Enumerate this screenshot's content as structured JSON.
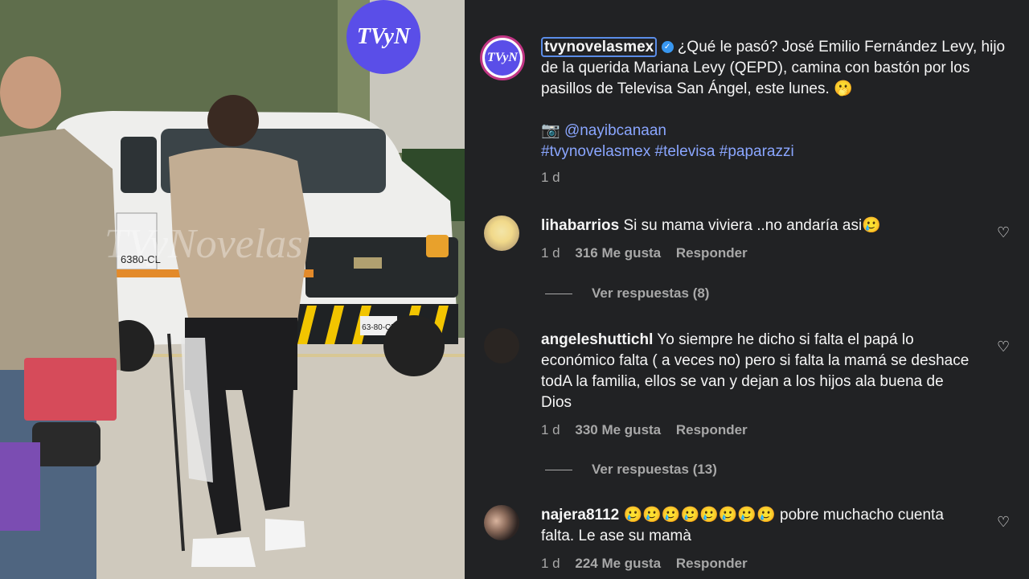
{
  "photo": {
    "logo_text": "TVyN",
    "watermark": "TVyNovelas",
    "van_text": "6380-CL",
    "plate_text": "63-80-CL"
  },
  "post": {
    "username": "tvynovelasmex",
    "caption": "¿Qué le pasó? José Emilio Fernández Levy, hijo de la querida Mariana Levy (QEPD), camina con bastón por los pasillos de Televisa San Ángel, este lunes. 🫢",
    "credit_icon": "📷",
    "credit": "@nayibcanaan",
    "hashtags": "#tvynovelasmex #televisa #paparazzi",
    "time": "1 d"
  },
  "comments": [
    {
      "user": "lihabarrios",
      "text": "Si su mama viviera ..no andaría asi🥲",
      "time": "1 d",
      "likes": "316 Me gusta",
      "reply": "Responder",
      "replies": "Ver respuestas (8)"
    },
    {
      "user": "angeleshuttichl",
      "text": "Yo siempre he dicho si falta el papá lo económico falta ( a veces no) pero si falta la mamá se deshace todA la familia, ellos se van y dejan a los hijos ala buena de Dios",
      "time": "1 d",
      "likes": "330 Me gusta",
      "reply": "Responder",
      "replies": "Ver respuestas (13)"
    },
    {
      "user": "najera8112",
      "text": "🥲🥲🥲🥲🥲🥲🥲🥲 pobre muchacho cuenta falta. Le ase su mamà",
      "time": "1 d",
      "likes": "224 Me gusta",
      "reply": "Responder"
    }
  ],
  "icons": {
    "heart": "heart-icon",
    "verified": "verified-badge-icon"
  },
  "colors": {
    "panel_bg": "#212224",
    "link": "#8aa6ff",
    "logo_bg": "#5a4ee8"
  }
}
